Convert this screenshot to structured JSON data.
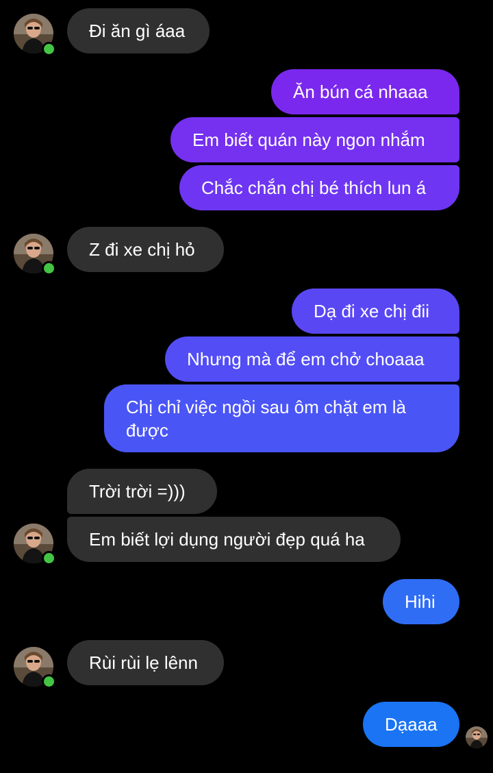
{
  "messages": [
    {
      "text": "Đi ăn gì áaa"
    },
    {
      "text": "Ăn bún cá nhaaa"
    },
    {
      "text": "Em biết quán này ngon nhắm"
    },
    {
      "text": "Chắc chắn chị bé thích lun á"
    },
    {
      "text": "Z đi xe chị hỏ"
    },
    {
      "text": "Dạ đi xe chị đii"
    },
    {
      "text": "Nhưng mà để em chở choaaa"
    },
    {
      "text": "Chị chỉ việc ngồi sau ôm chặt em là được"
    },
    {
      "text": "Trời trời =)))"
    },
    {
      "text": "Em biết lợi dụng người đẹp quá ha"
    },
    {
      "text": "Hihi"
    },
    {
      "text": "Rùi rùi lẹ lênn"
    },
    {
      "text": "Dạaaa"
    }
  ],
  "colors": {
    "background": "#000000",
    "incoming_bubble": "#303030",
    "outgoing_gradient_top": "#8a2be2",
    "outgoing_gradient_bottom": "#1877f2",
    "online_dot": "#44c445"
  },
  "icons": {
    "avatar": "contact-avatar",
    "online": "online-status-dot",
    "seen": "seen-receipt-avatar"
  }
}
